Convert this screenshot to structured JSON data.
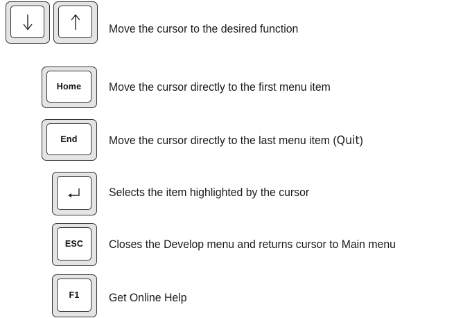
{
  "rows": [
    {
      "keys": [
        {
          "icon": "arrow-down-icon",
          "glyph": "↓"
        },
        {
          "icon": "arrow-up-icon",
          "glyph": "↑"
        }
      ],
      "description": "Move the cursor to the desired function"
    },
    {
      "keys": [
        {
          "label": "Home"
        }
      ],
      "description": "Move the cursor directly to the first menu item"
    },
    {
      "keys": [
        {
          "label": "End"
        }
      ],
      "description_main": "Move the cursor directly to the last menu item (",
      "description_emph": "Quit",
      "description_end": ")"
    },
    {
      "keys": [
        {
          "icon": "enter-icon",
          "glyph": "↵"
        }
      ],
      "description": "Selects the item highlighted by the cursor"
    },
    {
      "keys": [
        {
          "label": "ESC"
        }
      ],
      "description": "Closes the Develop menu and returns cursor to Main menu"
    },
    {
      "keys": [
        {
          "label": "F1"
        }
      ],
      "description": "Get Online Help"
    }
  ]
}
